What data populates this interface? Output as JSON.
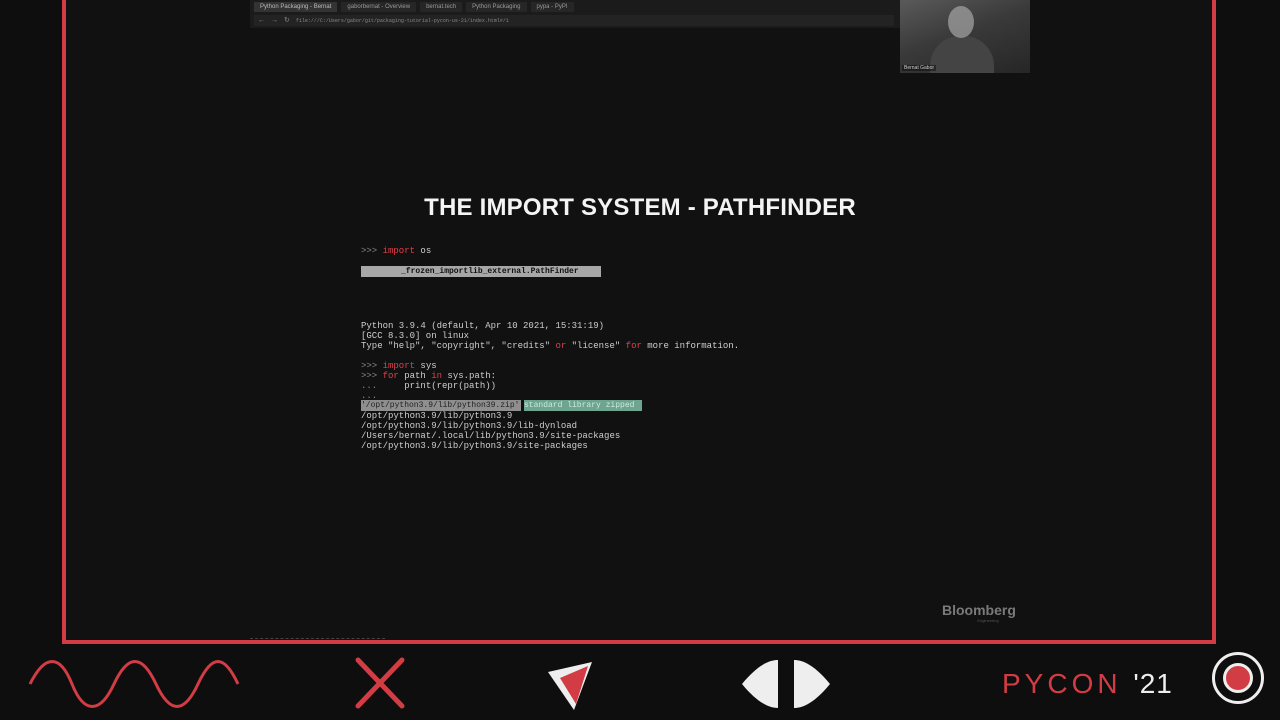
{
  "browser": {
    "tabs": [
      "Python Packaging - Bernat",
      "gaborbernat - Overview",
      "bernat.tech",
      "Python Packaging",
      "pypa - PyPI"
    ],
    "url": "file:///C:/Users/gabor/git/packaging-tutorial-pycon-us-21/index.html#/1"
  },
  "webcam": {
    "name": "Bernat Gabor"
  },
  "slide": {
    "title": "THE IMPORT SYSTEM - PATHFINDER",
    "code1_prompt": ">>> ",
    "code1_kw": "import",
    "code1_rest": " os",
    "highlight": "_frozen_importlib_external.PathFinder",
    "banner_line1": "Python 3.9.4 (default, Apr 10 2021, 15:31:19)",
    "banner_line2": "[GCC 8.3.0] on linux",
    "banner_line3_a": "Type \"help\", \"copyright\", \"credits\" ",
    "banner_line3_or": "or",
    "banner_line3_b": " \"license\" ",
    "banner_line3_for": "for",
    "banner_line3_c": " more information.",
    "repl1_prompt": ">>> ",
    "repl1_kw": "import",
    "repl1_rest": " sys",
    "repl2_prompt": ">>> ",
    "repl2_kw": "for",
    "repl2_mid": " path ",
    "repl2_kw2": "in",
    "repl2_rest": " sys.path:",
    "repl3_prompt": "...     ",
    "repl3_rest": "print(repr(path))",
    "repl4_prompt": "...",
    "hl_path": "'/opt/python3.9/lib/python39.zip'",
    "hl_note": "standard library zipped",
    "paths": [
      "/opt/python3.9/lib/python3.9",
      "/opt/python3.9/lib/python3.9/lib-dynload",
      "/Users/bernat/.local/lib/python3.9/site-packages",
      "/opt/python3.9/lib/python3.9/site-packages"
    ]
  },
  "sponsor": {
    "name": "Bloomberg",
    "sub": "Engineering"
  },
  "footer": {
    "pycon": "PYCON",
    "year": "'21"
  },
  "colors": {
    "accent": "#d23c44",
    "highlight_green": "#6da590"
  }
}
